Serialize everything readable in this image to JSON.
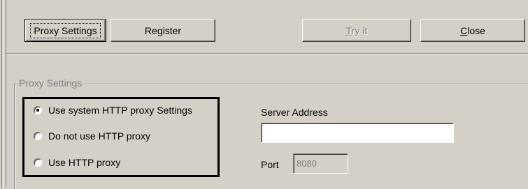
{
  "buttons": {
    "proxy_settings": "Proxy Settings",
    "register": "Register",
    "try_it": "Try it",
    "try_it_mnemonic": "T",
    "try_it_rest": "ry it",
    "close": "Close",
    "close_mnemonic": "C",
    "close_rest": "lose"
  },
  "group": {
    "title": "Proxy Settings",
    "options": [
      {
        "label": "Use system HTTP proxy Settings",
        "checked": true
      },
      {
        "label": "Do not use HTTP proxy",
        "checked": false
      },
      {
        "label": "Use HTTP proxy",
        "checked": false
      }
    ]
  },
  "server": {
    "label": "Server Address",
    "value": ""
  },
  "port": {
    "label": "Port",
    "value": "8080"
  }
}
